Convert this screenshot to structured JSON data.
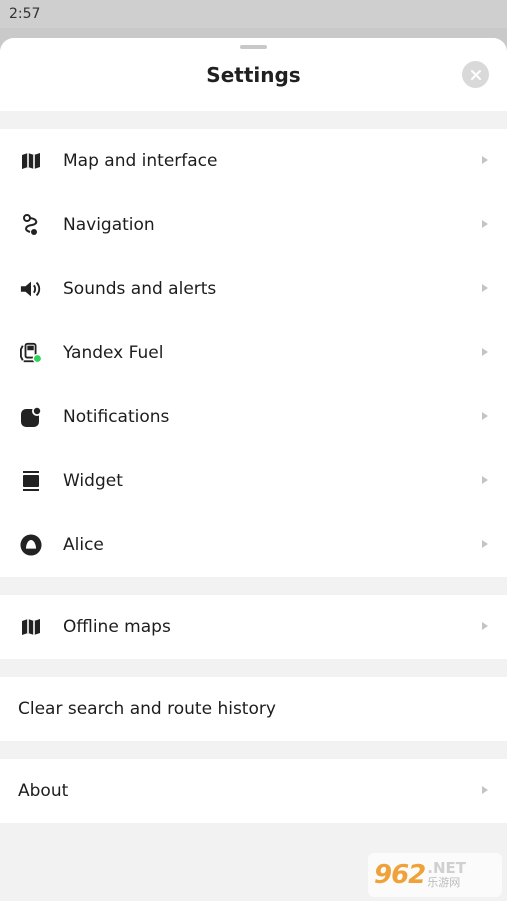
{
  "status_bar": {
    "time": "2:57"
  },
  "header": {
    "title": "Settings"
  },
  "groups": [
    {
      "items": [
        {
          "label": "Map and interface",
          "icon": "map-icon"
        },
        {
          "label": "Navigation",
          "icon": "route-icon"
        },
        {
          "label": "Sounds and alerts",
          "icon": "speaker-icon"
        },
        {
          "label": "Yandex Fuel",
          "icon": "fuel-pump-icon"
        },
        {
          "label": "Notifications",
          "icon": "notification-icon"
        },
        {
          "label": "Widget",
          "icon": "widget-icon"
        },
        {
          "label": "Alice",
          "icon": "alice-icon"
        }
      ]
    },
    {
      "items": [
        {
          "label": "Offline maps",
          "icon": "map-icon"
        }
      ]
    },
    {
      "items": [
        {
          "label": "Clear search and route history"
        }
      ]
    },
    {
      "items": [
        {
          "label": "About"
        }
      ]
    }
  ],
  "watermark": {
    "number": "962",
    "net": ".NET",
    "cn": "乐游网"
  },
  "colors": {
    "fuel_badge": "#2fd15a",
    "icon": "#222222",
    "chevron": "#c4c4c4"
  }
}
